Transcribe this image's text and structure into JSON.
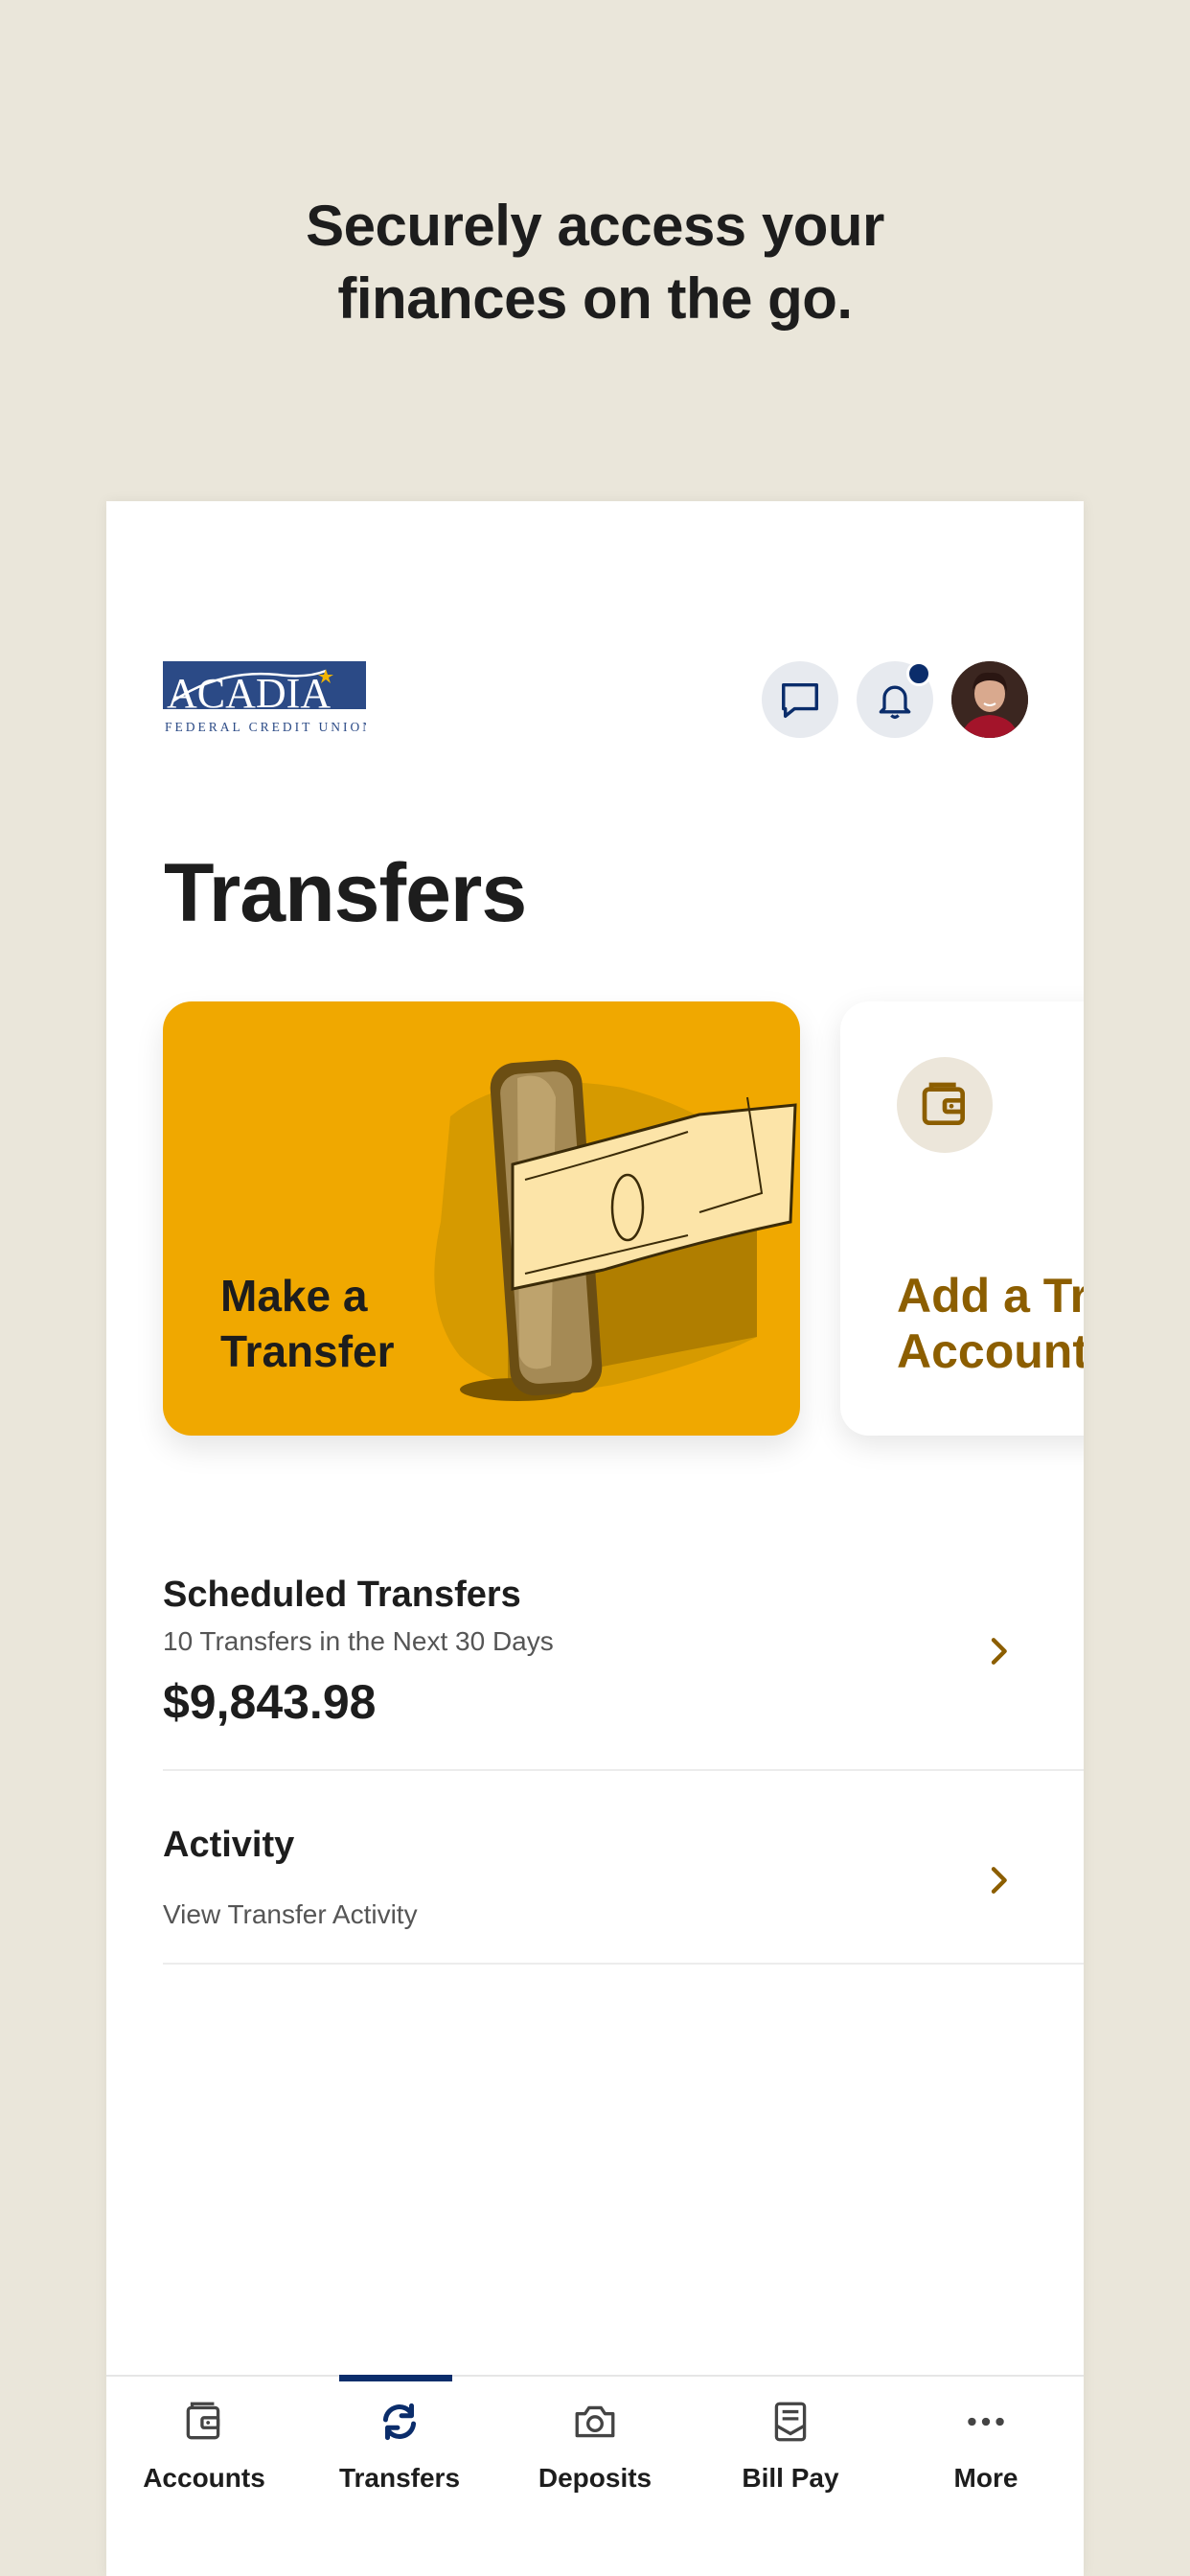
{
  "promo": {
    "line1": "Securely access your",
    "line2": "finances on the go."
  },
  "header": {
    "logo_text": "ACADIA",
    "logo_subtext": "FEDERAL CREDIT UNION",
    "icons": [
      "chat-icon",
      "bell-icon",
      "avatar"
    ],
    "has_notification": true
  },
  "page": {
    "title": "Transfers"
  },
  "cards": {
    "make_transfer": {
      "line1": "Make a",
      "line2": "Transfer"
    },
    "add_account": {
      "line1": "Add a Tr",
      "line2": "Account"
    }
  },
  "scheduled": {
    "title": "Scheduled Transfers",
    "subtitle": "10 Transfers in the Next 30 Days",
    "amount": "$9,843.98"
  },
  "activity": {
    "title": "Activity",
    "subtitle": "View Transfer Activity"
  },
  "nav": {
    "items": [
      {
        "label": "Accounts",
        "icon": "wallet-icon"
      },
      {
        "label": "Transfers",
        "icon": "transfer-arrows-icon"
      },
      {
        "label": "Deposits",
        "icon": "camera-icon"
      },
      {
        "label": "Bill Pay",
        "icon": "bill-icon"
      },
      {
        "label": "More",
        "icon": "more-dots-icon"
      }
    ],
    "active": "Transfers"
  },
  "colors": {
    "background": "#EAE6DA",
    "brand_navy": "#0B2D6B",
    "accent_gold": "#F0A800",
    "accent_brown": "#8C5E00"
  }
}
